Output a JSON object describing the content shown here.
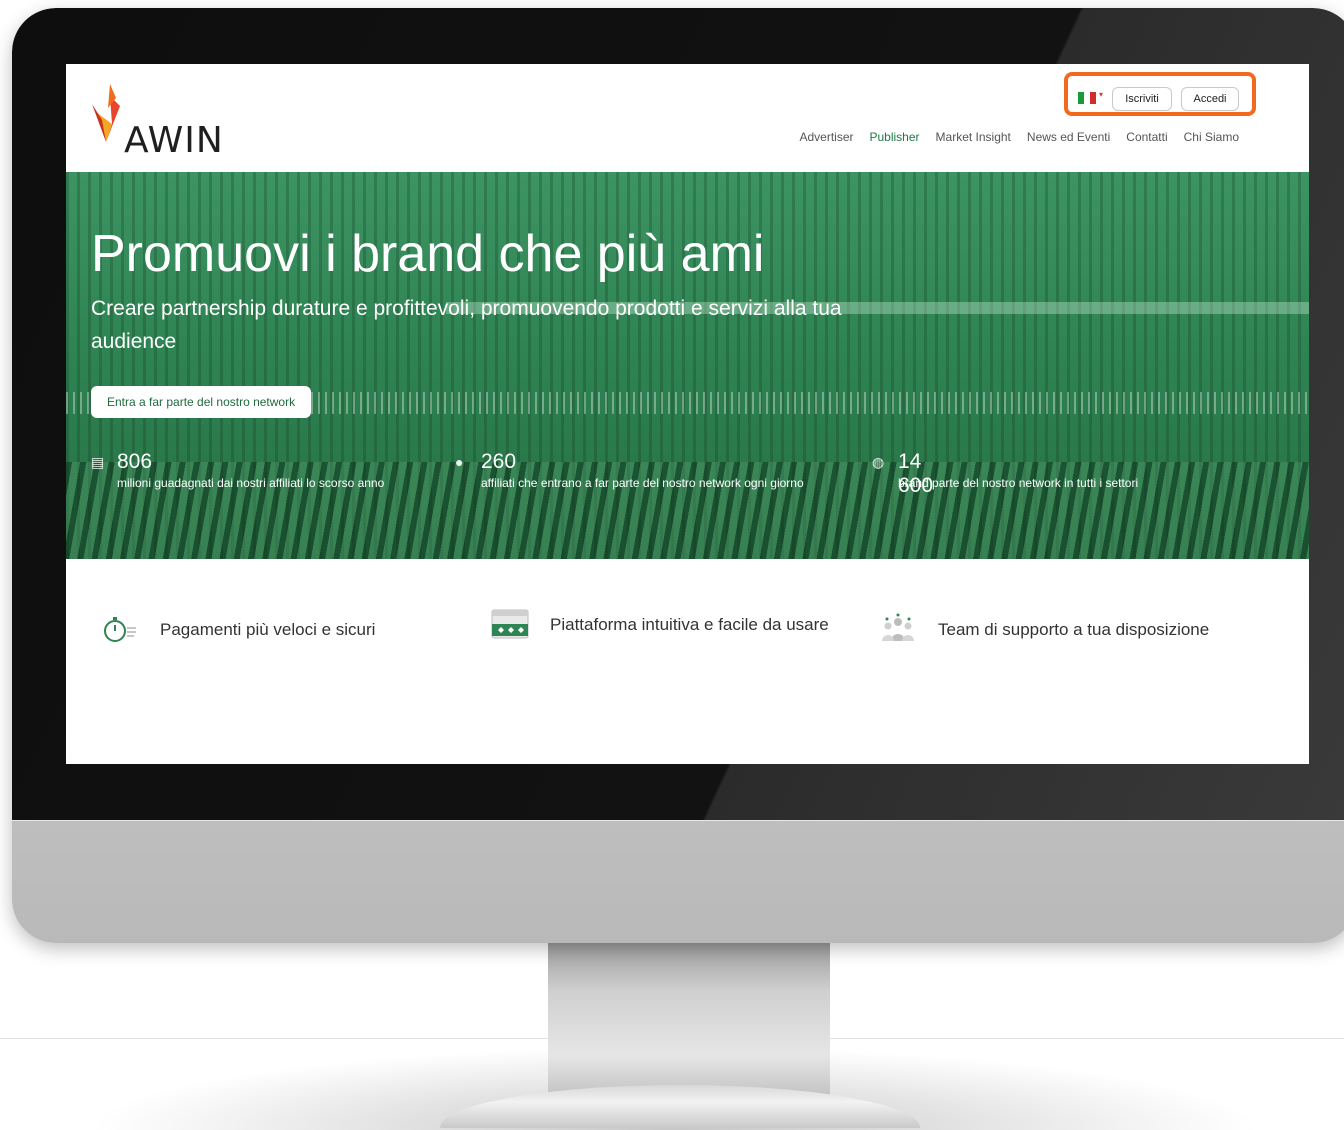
{
  "header": {
    "logo_text": "AWIN",
    "signup_label": "Iscriviti",
    "login_label": "Accedi",
    "highlight_color": "#f26b1d",
    "nav": [
      {
        "label": "Advertiser"
      },
      {
        "label": "Publisher",
        "active": true
      },
      {
        "label": "Market Insight"
      },
      {
        "label": "News ed Eventi"
      },
      {
        "label": "Contatti"
      },
      {
        "label": "Chi Siamo"
      }
    ]
  },
  "hero": {
    "title": "Promuovi i brand che più ami",
    "subtitle": "Creare partnership durature e profittevoli, promuovendo prodotti e servizi alla tua audience",
    "cta_label": "Entra a far parte del nostro network",
    "stats": [
      {
        "icon": "coins-icon",
        "value": "806",
        "label": "milioni guadagnati dai nostri affiliati lo scorso anno"
      },
      {
        "icon": "user-icon",
        "value": "260",
        "label": "affiliati che entrano a far parte del nostro network ogni giorno"
      },
      {
        "icon": "globe-icon",
        "value": "14 600",
        "label": "brand parte del nostro network in tutti i settori"
      }
    ]
  },
  "features": [
    {
      "icon": "stopwatch-icon",
      "text": "Pagamenti più veloci e sicuri"
    },
    {
      "icon": "platform-icon",
      "text": "Piattaforma intuitiva e facile da usare"
    },
    {
      "icon": "team-icon",
      "text": "Team di supporto a tua disposizione"
    }
  ],
  "colors": {
    "brand_green": "#2f8453",
    "text": "#333333"
  }
}
